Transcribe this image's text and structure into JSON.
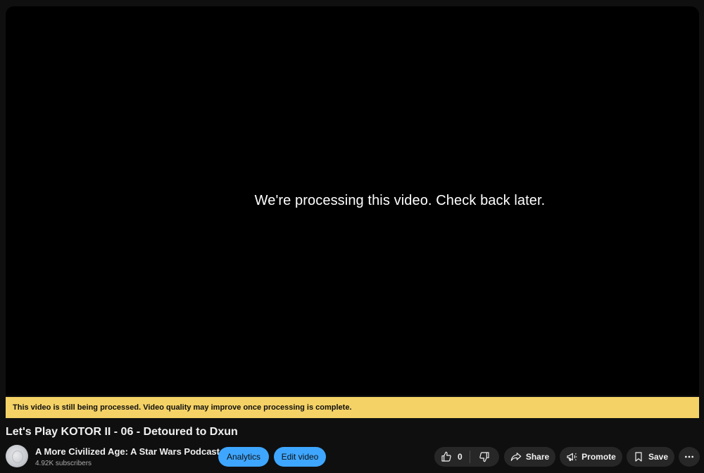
{
  "player": {
    "message": "We're processing this video. Check back later."
  },
  "banner": {
    "text": "This video is still being processed. Video quality may improve once processing is complete.",
    "color": "#f4d266"
  },
  "video": {
    "title": "Let's Play KOTOR II - 06 - Detoured to Dxun"
  },
  "channel": {
    "name": "A More Civilized Age: A Star Wars Podcast",
    "subscribers": "4.92K subscribers"
  },
  "buttons": {
    "analytics": "Analytics",
    "edit_video": "Edit video",
    "like_count": "0",
    "share": "Share",
    "promote": "Promote",
    "save": "Save"
  },
  "icons": {
    "like": "thumbs-up-icon",
    "dislike": "thumbs-down-icon",
    "share": "share-arrow-icon",
    "promote": "megaphone-icon",
    "save": "bookmark-icon",
    "more": "more-horizontal-icon"
  },
  "colors": {
    "accent_blue": "#3ea6ff",
    "background": "#0f0f0f",
    "button_grey": "#272727"
  }
}
